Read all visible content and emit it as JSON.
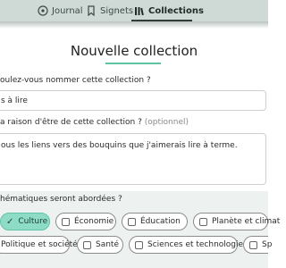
{
  "nav": {
    "tabs": [
      {
        "label": "Journal",
        "icon": "journal-icon"
      },
      {
        "label": "Signets",
        "icon": "bookmark-icon"
      },
      {
        "label": "Collections",
        "icon": "collections-icon",
        "active": true
      }
    ]
  },
  "form": {
    "title": "Nouvelle collection",
    "name_label": "oulez-vous nommer cette collection ?",
    "name_value": "s à lire",
    "reason_label": "a raison d'être de cette collection ?",
    "reason_optional": "(optionnel)",
    "reason_value": "ous les liens vers des bouquins que j'aimerais lire à terme.",
    "themes_label": "hématiques seront abordées ?",
    "themes": [
      {
        "label": "Culture",
        "selected": true
      },
      {
        "label": "Économie",
        "selected": false
      },
      {
        "label": "Éducation",
        "selected": false
      },
      {
        "label": "Planète et climat",
        "selected": false
      },
      {
        "label": "Politique et société",
        "selected": false
      },
      {
        "label": "Santé",
        "selected": false
      },
      {
        "label": "Sciences et technologies",
        "selected": false
      },
      {
        "label": "Sp",
        "selected": false
      }
    ]
  },
  "colors": {
    "accent": "#5ec3a3",
    "selected_chip": "#8fdcc6",
    "nav_bg": "#cfd9d5",
    "panel_bg": "#edf2f1"
  }
}
